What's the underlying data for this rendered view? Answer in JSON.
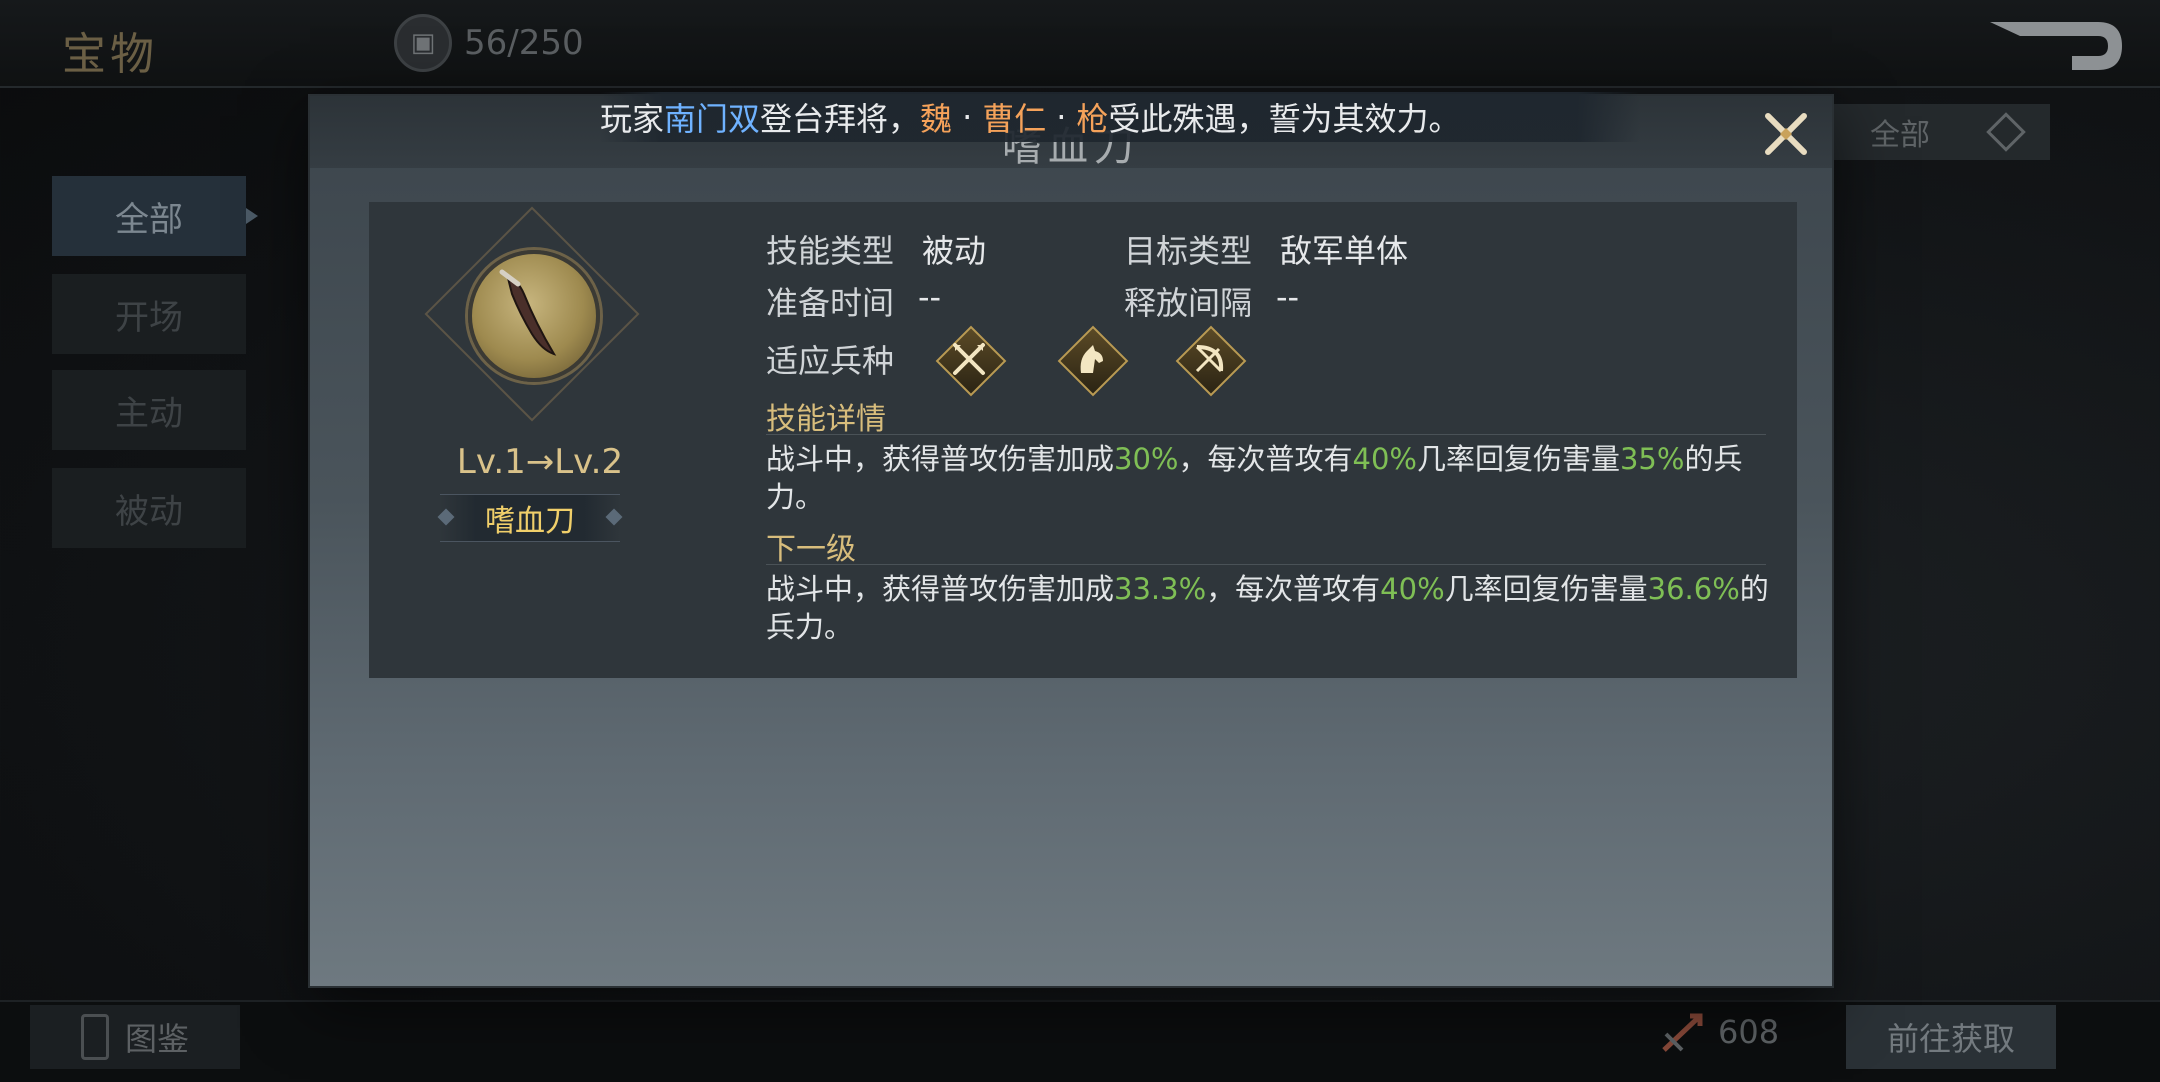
{
  "screen": {
    "title": "宝物",
    "capacity": "56/250",
    "filter_label": "全部",
    "side_tabs": [
      "全部",
      "开场",
      "主动",
      "被动"
    ],
    "codex_label": "图鉴",
    "currency_amount": "608",
    "goto_label": "前往获取"
  },
  "ticker": {
    "prefix": "玩家",
    "player": "南门双",
    "mid": "登台拜将，",
    "faction": "魏",
    "sep1": "·",
    "general": "曹仁",
    "sep2": "·",
    "unit": "枪",
    "suffix": "受此殊遇，誓为其效力。"
  },
  "modal": {
    "title": "嗜血刀",
    "item": {
      "level": "Lv.1→Lv.2",
      "name": "嗜血刀"
    },
    "stats": {
      "skill_type_label": "技能类型",
      "skill_type_value": "被动",
      "target_type_label": "目标类型",
      "target_type_value": "敌军单体",
      "prep_time_label": "准备时间",
      "prep_time_value": "--",
      "interval_label": "释放间隔",
      "interval_value": "--",
      "troops_label": "适应兵种",
      "troop_icons": [
        "spear-icon",
        "cavalry-horse-icon",
        "bow-icon"
      ]
    },
    "detail": {
      "title": "技能详情",
      "t1": "战斗中，获得普攻伤害加成",
      "v1": "30%",
      "t2": "，每次普攻有",
      "v2": "40%",
      "t3": "几率回复伤害量",
      "v3": "35%",
      "t4": "的兵力。"
    },
    "next": {
      "title": "下一级",
      "t1": "战斗中，获得普攻伤害加成",
      "v1": "33.3%",
      "t2": "，每次普攻有",
      "v2": "40%",
      "t3": "几率回复伤害量",
      "v3": "36.6%",
      "t4": "的兵力。"
    }
  },
  "colors": {
    "highlight_green": "#7fbf55",
    "name_gold": "#f0cf6a",
    "section_gold": "#d8bd7c",
    "player_blue": "#6fb2ff",
    "faction_orange": "#f5a25a"
  }
}
